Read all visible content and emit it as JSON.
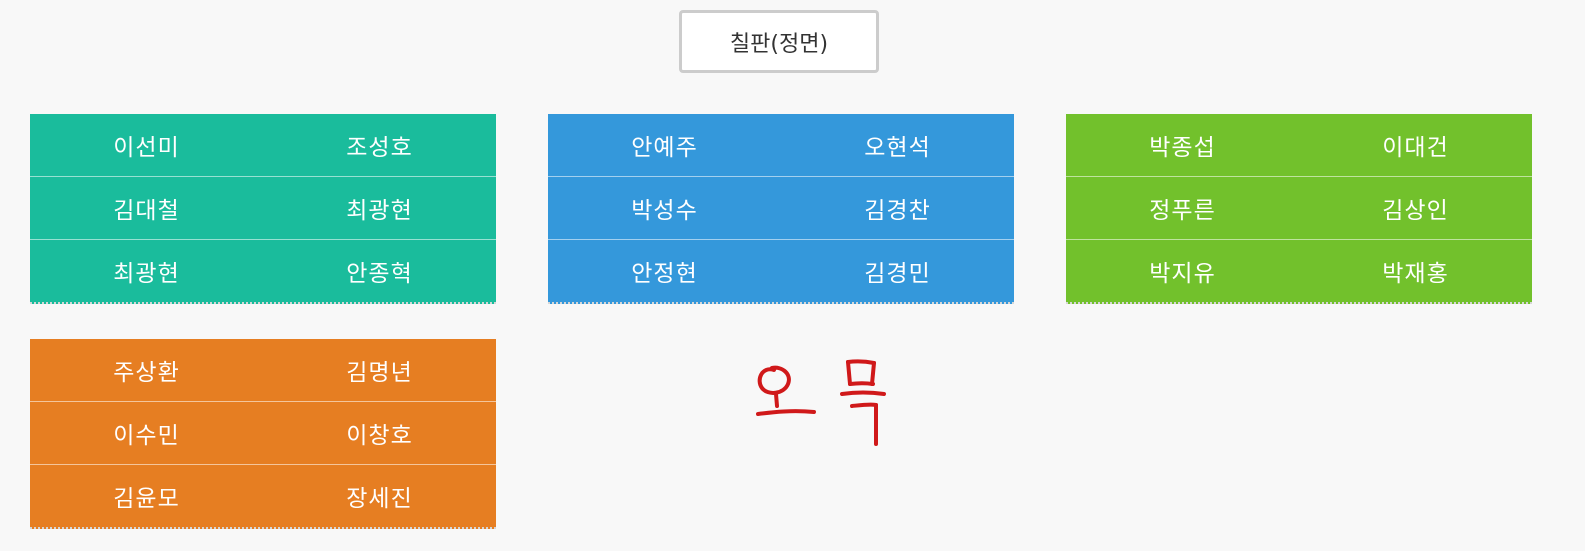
{
  "board_label": "칠판(정면)",
  "colors": {
    "teal": "#1abc9c",
    "blue": "#3498db",
    "green": "#72c12c",
    "orange": "#e67e22",
    "handwriting": "#d0191a"
  },
  "groups": [
    {
      "name": "teal",
      "rows": [
        [
          "이선미",
          "조성호"
        ],
        [
          "김대철",
          "최광현"
        ],
        [
          "최광현",
          "안종혁"
        ]
      ]
    },
    {
      "name": "blue",
      "rows": [
        [
          "안예주",
          "오현석"
        ],
        [
          "박성수",
          "김경찬"
        ],
        [
          "안정현",
          "김경민"
        ]
      ]
    },
    {
      "name": "green",
      "rows": [
        [
          "박종섭",
          "이대건"
        ],
        [
          "정푸른",
          "김상인"
        ],
        [
          "박지유",
          "박재홍"
        ]
      ]
    },
    {
      "name": "orange",
      "rows": [
        [
          "주상환",
          "김명년"
        ],
        [
          "이수민",
          "이창호"
        ],
        [
          "김윤모",
          "장세진"
        ]
      ]
    }
  ],
  "handwritten_note": "오목"
}
